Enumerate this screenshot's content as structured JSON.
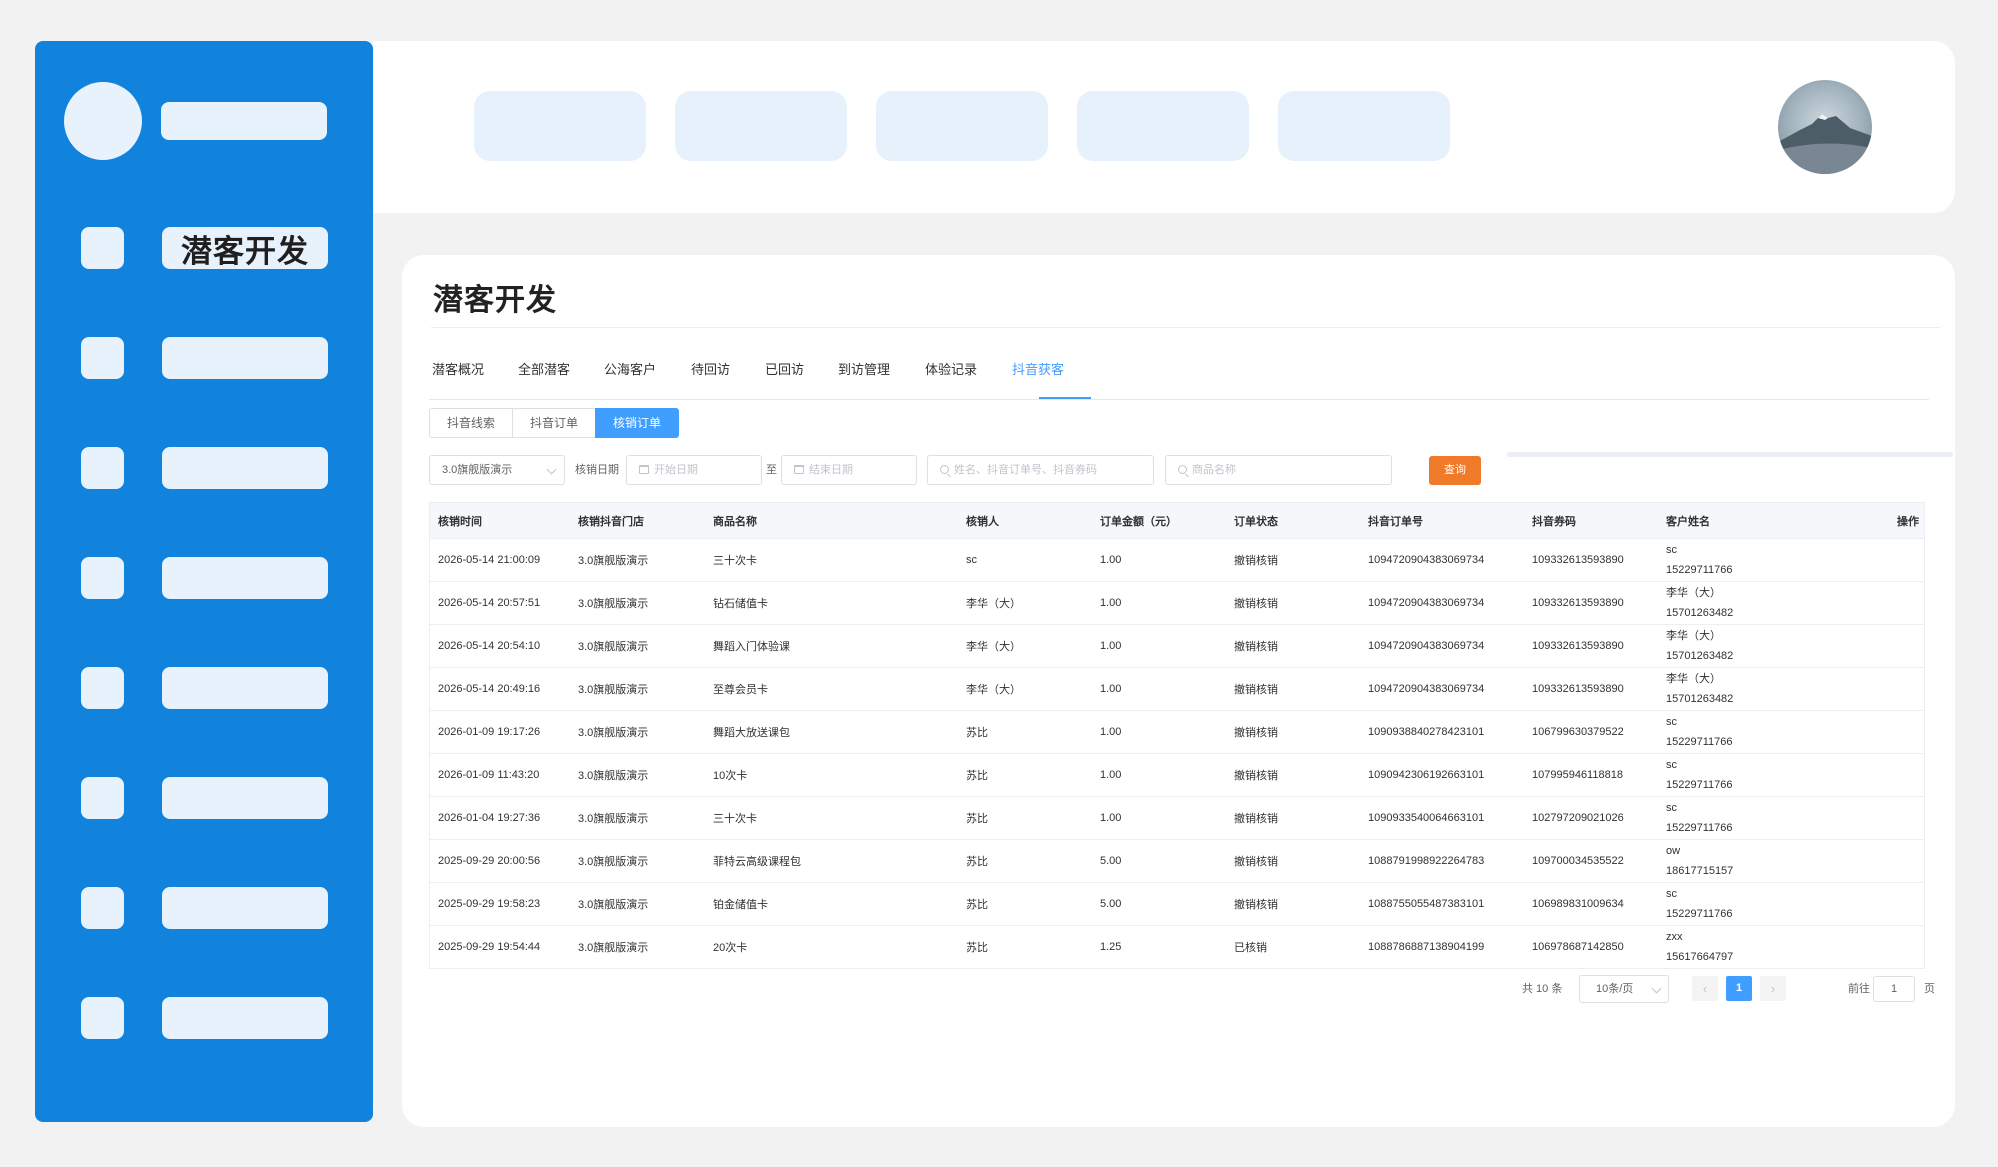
{
  "sidebar": {
    "active_item": "潜客开发"
  },
  "page": {
    "title": "潜客开发"
  },
  "tabs": [
    "潜客概况",
    "全部潜客",
    "公海客户",
    "待回访",
    "已回访",
    "到访管理",
    "体验记录",
    "抖音获客"
  ],
  "active_tab": "抖音获客",
  "subtabs": [
    "抖音线索",
    "抖音订单",
    "核销订单"
  ],
  "active_subtab": "核销订单",
  "filters": {
    "store_value": "3.0旗舰版演示",
    "date_label": "核销日期",
    "start_placeholder": "开始日期",
    "range_sep": "至",
    "end_placeholder": "结束日期",
    "keyword_placeholder": "姓名、抖音订单号、抖音券码",
    "product_placeholder": "商品名称",
    "query_label": "查询"
  },
  "table": {
    "headers": [
      "核销时间",
      "核销抖音门店",
      "商品名称",
      "核销人",
      "订单金额（元）",
      "订单状态",
      "抖音订单号",
      "抖音券码",
      "客户姓名",
      "操作"
    ],
    "rows": [
      {
        "time": "2026-05-14 21:00:09",
        "store": "3.0旗舰版演示",
        "product": "三十次卡",
        "operator": "sc",
        "amount": "1.00",
        "status": "撤销核销",
        "order_no": "1094720904383069734",
        "coupon": "109332613593890",
        "customer_name": "sc",
        "customer_phone": "15229711766"
      },
      {
        "time": "2026-05-14 20:57:51",
        "store": "3.0旗舰版演示",
        "product": "钻石储值卡",
        "operator": "李华（大）",
        "amount": "1.00",
        "status": "撤销核销",
        "order_no": "1094720904383069734",
        "coupon": "109332613593890",
        "customer_name": "李华（大）",
        "customer_phone": "15701263482"
      },
      {
        "time": "2026-05-14 20:54:10",
        "store": "3.0旗舰版演示",
        "product": "舞蹈入门体验课",
        "operator": "李华（大）",
        "amount": "1.00",
        "status": "撤销核销",
        "order_no": "1094720904383069734",
        "coupon": "109332613593890",
        "customer_name": "李华（大）",
        "customer_phone": "15701263482"
      },
      {
        "time": "2026-05-14 20:49:16",
        "store": "3.0旗舰版演示",
        "product": "至尊会员卡",
        "operator": "李华（大）",
        "amount": "1.00",
        "status": "撤销核销",
        "order_no": "1094720904383069734",
        "coupon": "109332613593890",
        "customer_name": "李华（大）",
        "customer_phone": "15701263482"
      },
      {
        "time": "2026-01-09 19:17:26",
        "store": "3.0旗舰版演示",
        "product": "舞蹈大放送课包",
        "operator": "苏比",
        "amount": "1.00",
        "status": "撤销核销",
        "order_no": "1090938840278423101",
        "coupon": "106799630379522",
        "customer_name": "sc",
        "customer_phone": "15229711766"
      },
      {
        "time": "2026-01-09 11:43:20",
        "store": "3.0旗舰版演示",
        "product": "10次卡",
        "operator": "苏比",
        "amount": "1.00",
        "status": "撤销核销",
        "order_no": "1090942306192663101",
        "coupon": "107995946118818",
        "customer_name": "sc",
        "customer_phone": "15229711766"
      },
      {
        "time": "2026-01-04 19:27:36",
        "store": "3.0旗舰版演示",
        "product": "三十次卡",
        "operator": "苏比",
        "amount": "1.00",
        "status": "撤销核销",
        "order_no": "1090933540064663101",
        "coupon": "102797209021026",
        "customer_name": "sc",
        "customer_phone": "15229711766"
      },
      {
        "time": "2025-09-29 20:00:56",
        "store": "3.0旗舰版演示",
        "product": "菲特云高级课程包",
        "operator": "苏比",
        "amount": "5.00",
        "status": "撤销核销",
        "order_no": "1088791998922264783",
        "coupon": "109700034535522",
        "customer_name": "ow",
        "customer_phone": "18617715157"
      },
      {
        "time": "2025-09-29 19:58:23",
        "store": "3.0旗舰版演示",
        "product": "铂金储值卡",
        "operator": "苏比",
        "amount": "5.00",
        "status": "撤销核销",
        "order_no": "1088755055487383101",
        "coupon": "106989831009634",
        "customer_name": "sc",
        "customer_phone": "15229711766"
      },
      {
        "time": "2025-09-29 19:54:44",
        "store": "3.0旗舰版演示",
        "product": "20次卡",
        "operator": "苏比",
        "amount": "1.25",
        "status": "已核销",
        "order_no": "1088786887138904199",
        "coupon": "106978687142850",
        "customer_name": "zxx",
        "customer_phone": "15617664797"
      }
    ]
  },
  "pagination": {
    "total": "共 10 条",
    "page_size": "10条/页",
    "prev": "‹",
    "current": "1",
    "next": "›",
    "goto_label": "前往",
    "goto_value": "1",
    "goto_unit": "页"
  },
  "colors": {
    "sidebar": "#1283dd",
    "accent": "#409eff",
    "query_button": "#f07a28"
  }
}
